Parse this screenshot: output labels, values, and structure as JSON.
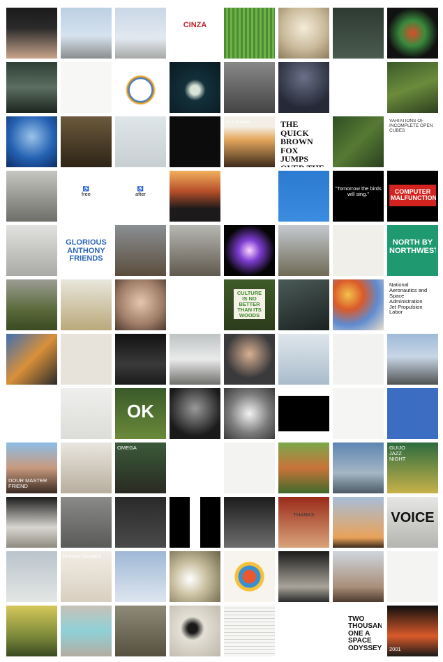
{
  "grid": {
    "columns": 8,
    "rows": 12,
    "tiles": [
      {
        "bg": "linear-gradient(180deg,#1a1a1a 0%,#2a2a2a 40%,#c9a58c 100%)"
      },
      {
        "bg": "linear-gradient(180deg,#bcd0e4 0%,#d6e2ee 55%,#8a8f8e 100%)"
      },
      {
        "bg": "linear-gradient(180deg,#c9d7e6 0%,#e2e9f1 60%,#a8a9a6 100%)"
      },
      {
        "bg": "#ffffff",
        "text": "CINZA",
        "fg": "#c0262c",
        "style": "boxed"
      },
      {
        "bg": "repeating-linear-gradient(90deg,#4c8c32 0 3px,#6fb24a 3px 6px)"
      },
      {
        "bg": "radial-gradient(circle at 50% 40%,#f4ecd9 0%,#c9b99a 55%,#8c7c5c 100%)"
      },
      {
        "bg": "linear-gradient(180deg,#2d3a33 0%,#4b5b4e 100%)"
      },
      {
        "bg": "radial-gradient(circle at 50% 50%,#d94e2a 0%,#3a8a3e 35%,#111 70%)"
      },
      {
        "bg": "linear-gradient(180deg,#2e3f36 0%,#5b6e60 50%,#1c2520 100%)"
      },
      {
        "bg": "#f7f7f5"
      },
      {
        "bg": "radial-gradient(circle at 50% 55%,#ffffff 0 28%,#2b6fd1 30%,#e9a21e 36%,#ffffff 40%)"
      },
      {
        "bg": "radial-gradient(circle at 50% 55%,#d9e4d8 0 12%,#13303a 28%,#0a1a22 100%)"
      },
      {
        "bg": "linear-gradient(180deg,#888 0%,#444 100%)"
      },
      {
        "bg": "radial-gradient(circle at 50% 30%,#6a7187 0%,#262a38 70%)"
      },
      {
        "bg": "#ffffff"
      },
      {
        "bg": "linear-gradient(160deg,#3a5a2a 0%,#6b8c3c 50%,#2e3e1e 100%)"
      },
      {
        "bg": "radial-gradient(circle at 50% 40%,#9bc3ea 0%,#2462b3 55%,#0d2d66 100%)"
      },
      {
        "bg": "linear-gradient(180deg,#6b5a3c 0%,#2e2416 100%)"
      },
      {
        "bg": "linear-gradient(180deg,#dfe6ea 0%,#c8cfd2 100%)"
      },
      {
        "bg": "#0c0c0c"
      },
      {
        "bg": "linear-gradient(180deg,#f3efe6 0 20%,#e6a85e 45%,#3b2a1a 100%)",
        "text": "in Canada",
        "fg": "#ffffff",
        "style": "top"
      },
      {
        "bg": "#ffffff",
        "text": "THE QUICK\nBROWN\nFOX JUMPS\nOVER THE\nLAZY DOG",
        "fg": "#111111",
        "style": "big"
      },
      {
        "bg": "linear-gradient(135deg,#2f4f24 0%,#567a34 50%,#2a4020 100%)"
      },
      {
        "bg": "#ffffff",
        "text": "VARIATIONS OF INCOMPLETE OPEN CUBES",
        "fg": "#333333",
        "style": "small"
      },
      {
        "bg": "linear-gradient(180deg,#c6c6c2 0%,#6e6e69 100%)"
      },
      {
        "bg": "#ffffff",
        "text": "♿\nfree",
        "fg": "#111111",
        "style": "center"
      },
      {
        "bg": "#ffffff",
        "text": "♿\nafter",
        "fg": "#111111",
        "style": "center"
      },
      {
        "bg": "linear-gradient(180deg,#f2b05e 0%,#b8502a 40%,#1c1a1a 75%)"
      },
      {
        "bg": "#ffffff"
      },
      {
        "bg": "linear-gradient(180deg,#2b7ad1 0%,#3b8de0 100%)"
      },
      {
        "bg": "#000000",
        "text": "\"Tomorrow the birds will sing.\"",
        "fg": "#ffffff",
        "style": "center"
      },
      {
        "bg": "#000000",
        "text": "COMPUTER\nMALFUNCTION",
        "fg": "#ffffff",
        "style": "boxed-red"
      },
      {
        "bg": "linear-gradient(180deg,#e2e2e0 0%,#a9a9a5 100%)"
      },
      {
        "bg": "#ffffff",
        "text": "GLORIOUS\nANTHONY\nFRIENDS",
        "fg": "#2c66b8",
        "style": "boxed"
      },
      {
        "bg": "linear-gradient(180deg,#8a8f92 0%,#5b4d3d 100%)"
      },
      {
        "bg": "linear-gradient(180deg,#b7b7b3 0%,#605a4e 100%)"
      },
      {
        "bg": "radial-gradient(circle at 50% 50%,#ffd6ff 0%,#7d3dd1 30%,#050505 70%)"
      },
      {
        "bg": "linear-gradient(180deg,#c5cad0 0%,#6e6a55 100%)"
      },
      {
        "bg": "#f1efe9"
      },
      {
        "bg": "#1f9a70",
        "text": "NORTH BY\nNORTHWEST",
        "fg": "#ffffff",
        "style": "boxed"
      },
      {
        "bg": "linear-gradient(180deg,#9c9c94 0%,#5a6a3a 60%,#3a4a22 100%)"
      },
      {
        "bg": "linear-gradient(180deg,#e9e6dc 0%,#b9a97a 100%)"
      },
      {
        "bg": "radial-gradient(circle at 50% 45%,#e7c6ae 0%,#9d7b66 60%,#4a382e 100%)"
      },
      {
        "bg": "#ffffff"
      },
      {
        "bg": "linear-gradient(180deg,#3f5a28 0%,#2b3c1c 100%)",
        "text": "CULTURE\nIS NO\nBETTER\nTHAN ITS\nWOODS",
        "fg": "#3f8a2b",
        "style": "center-card"
      },
      {
        "bg": "linear-gradient(160deg,#4b5a58 0%,#1a2220 100%)"
      },
      {
        "bg": "radial-gradient(circle at 30% 30%,#f4c14a 0%,#d95a2a 30%,#5f8bd0 60%,#eadfca 100%)"
      },
      {
        "bg": "#ffffff",
        "text": "National Aeronautics and\nSpace Administration\nJet Propulsion Labor",
        "fg": "#111111",
        "style": "top"
      },
      {
        "bg": "linear-gradient(135deg,#3f6fb0 0%,#d9903a 50%,#2b2b2b 100%)"
      },
      {
        "bg": "#e8e3da"
      },
      {
        "bg": "linear-gradient(180deg,#111 0%,#3a3a3a 60%,#1a1a1a 100%)"
      },
      {
        "bg": "linear-gradient(180deg,#bfc3c4 0%,#e9eaea 50%,#6f6f6c 100%)"
      },
      {
        "bg": "radial-gradient(circle at 50% 40%,#d9b092 0%,#3a3a3c 60%)"
      },
      {
        "bg": "linear-gradient(180deg,#dfe6ec 0%,#a9bccb 100%)"
      },
      {
        "bg": "#f2f2f0"
      },
      {
        "bg": "linear-gradient(180deg,#9fb9d8 0%,#c8d6e6 45%,#4f5252 100%)"
      },
      {
        "bg": "#ffffff"
      },
      {
        "bg": "linear-gradient(180deg,#efefed 0%,#dcdcd9 100%)"
      },
      {
        "bg": "linear-gradient(180deg,#3a5a2a 0%,#6a8a3a 100%)",
        "text": "OK",
        "fg": "#ffffff",
        "style": "huge"
      },
      {
        "bg": "radial-gradient(circle at 50% 40%,#9a9a9a 0%,#1a1a1a 70%)"
      },
      {
        "bg": "radial-gradient(circle at 50% 50%,#f3f3f3 0%,#7b7b7b 55%,#3a3a3a 100%)"
      },
      {
        "bg": "linear-gradient(180deg,#fff 0 15%,#000 15% 85%,#fff 85%)"
      },
      {
        "bg": "#f5f5f3"
      },
      {
        "bg": "#3b6dc2"
      },
      {
        "bg": "linear-gradient(180deg,#8cbde6 0%,#c89a7e 50%,#3a2a22 100%)",
        "text": "DOUR MASTER FRIEND",
        "fg": "#ffffff",
        "style": "bottom"
      },
      {
        "bg": "linear-gradient(180deg,#e9e6df 0%,#b8ae9e 100%)"
      },
      {
        "bg": "linear-gradient(180deg,#3a5a3a 0%,#2a2a22 100%)",
        "text": "OMEGA",
        "fg": "#ffffff",
        "style": "top"
      },
      {
        "bg": "#ffffff"
      },
      {
        "bg": "#f3f3f1"
      },
      {
        "bg": "linear-gradient(180deg,#7aa84a 0%,#c9733a 50%,#3f6a2a 100%)"
      },
      {
        "bg": "linear-gradient(180deg,#5e85b2 0%,#a4b6c4 60%,#4b5a66 100%)"
      },
      {
        "bg": "linear-gradient(180deg,#2d6b3e 0%,#c7b24a 100%)",
        "text": "GUIJO\nJAZZ\nNIGHT",
        "fg": "#ffffff",
        "style": "top"
      },
      {
        "bg": "linear-gradient(180deg,#1a1a1a 0%,#d8d6d0 60%,#8e8a80 100%)"
      },
      {
        "bg": "linear-gradient(180deg,#8a8a88 0%,#5a5a58 100%)"
      },
      {
        "bg": "linear-gradient(180deg,#2a2a2a 0%,#4a4a4a 100%)"
      },
      {
        "bg": "linear-gradient(90deg,#000 0 40%,#fff 40% 60%,#000 60%)"
      },
      {
        "bg": "linear-gradient(180deg,#1c1c1c 0%,#6e6e6e 100%)"
      },
      {
        "bg": "linear-gradient(180deg,#9a2a1a 0%,#d9a47a 100%)",
        "text": "THANKS",
        "fg": "#333333",
        "style": "center"
      },
      {
        "bg": "linear-gradient(180deg,#a7bed8 0%,#e9a25a 80%,#3a2a1a 100%)"
      },
      {
        "bg": "linear-gradient(180deg,#e6e6e4 0%,#b4b4b1 100%)",
        "text": "VOICE",
        "fg": "#111111",
        "style": "huge-dark"
      },
      {
        "bg": "linear-gradient(180deg,#b9c4cc 0%,#e4e6e4 100%)"
      },
      {
        "bg": "linear-gradient(180deg,#f2eee6 0%,#d9cfc0 100%)",
        "text": "FUNNY GAMES",
        "fg": "#ffffff",
        "style": "top"
      },
      {
        "bg": "linear-gradient(180deg,#9fb8d6 0%,#dde6ef 100%)"
      },
      {
        "bg": "radial-gradient(circle at 40% 55%,#ffffff 0%,#cbc1a2 40%,#6b6146 100%)"
      },
      {
        "bg": "radial-gradient(circle at 50% 50%,#e9592d 0 18%,#3a8fd1 20% 30%,#f5c13a 32% 40%,#f7f4ee 42%)"
      },
      {
        "bg": "linear-gradient(180deg,#1a1a1a 0%,#a9a49a 70%,#2a2a2a 100%)"
      },
      {
        "bg": "linear-gradient(180deg,#cfd6de 0%,#a98f7a 70%,#4e3a2e 100%)"
      },
      {
        "bg": "#f4f4f2"
      },
      {
        "bg": "linear-gradient(180deg,#d6c85a 0%,#7c8a3a 60%,#3a4a22 100%)"
      },
      {
        "bg": "linear-gradient(180deg,#c7c1b6 0%,#8fd1d8 50%,#b3aca0 100%)"
      },
      {
        "bg": "linear-gradient(180deg,#8e8a78 0%,#56513e 100%)"
      },
      {
        "bg": "radial-gradient(circle at 45% 45%,#1a1a1a 0 12%,#e4e0d6 30%,#bdb7a8 100%)"
      },
      {
        "bg": "repeating-linear-gradient(0deg,#f6f6f4 0 4px,#d0d0cc 4px 5px)"
      },
      {
        "bg": "#ffffff"
      },
      {
        "bg": "#ffffff",
        "text": "TWO\nTHOUSAND\nONE A SPACE\nODYSSEY",
        "fg": "#111111",
        "style": "bottom-bold"
      },
      {
        "bg": "linear-gradient(180deg,#0e0e0e 0%,#d95a2a 60%,#1a1a1a 100%)",
        "text": "2001",
        "fg": "#ffffff",
        "style": "bottom"
      }
    ]
  }
}
